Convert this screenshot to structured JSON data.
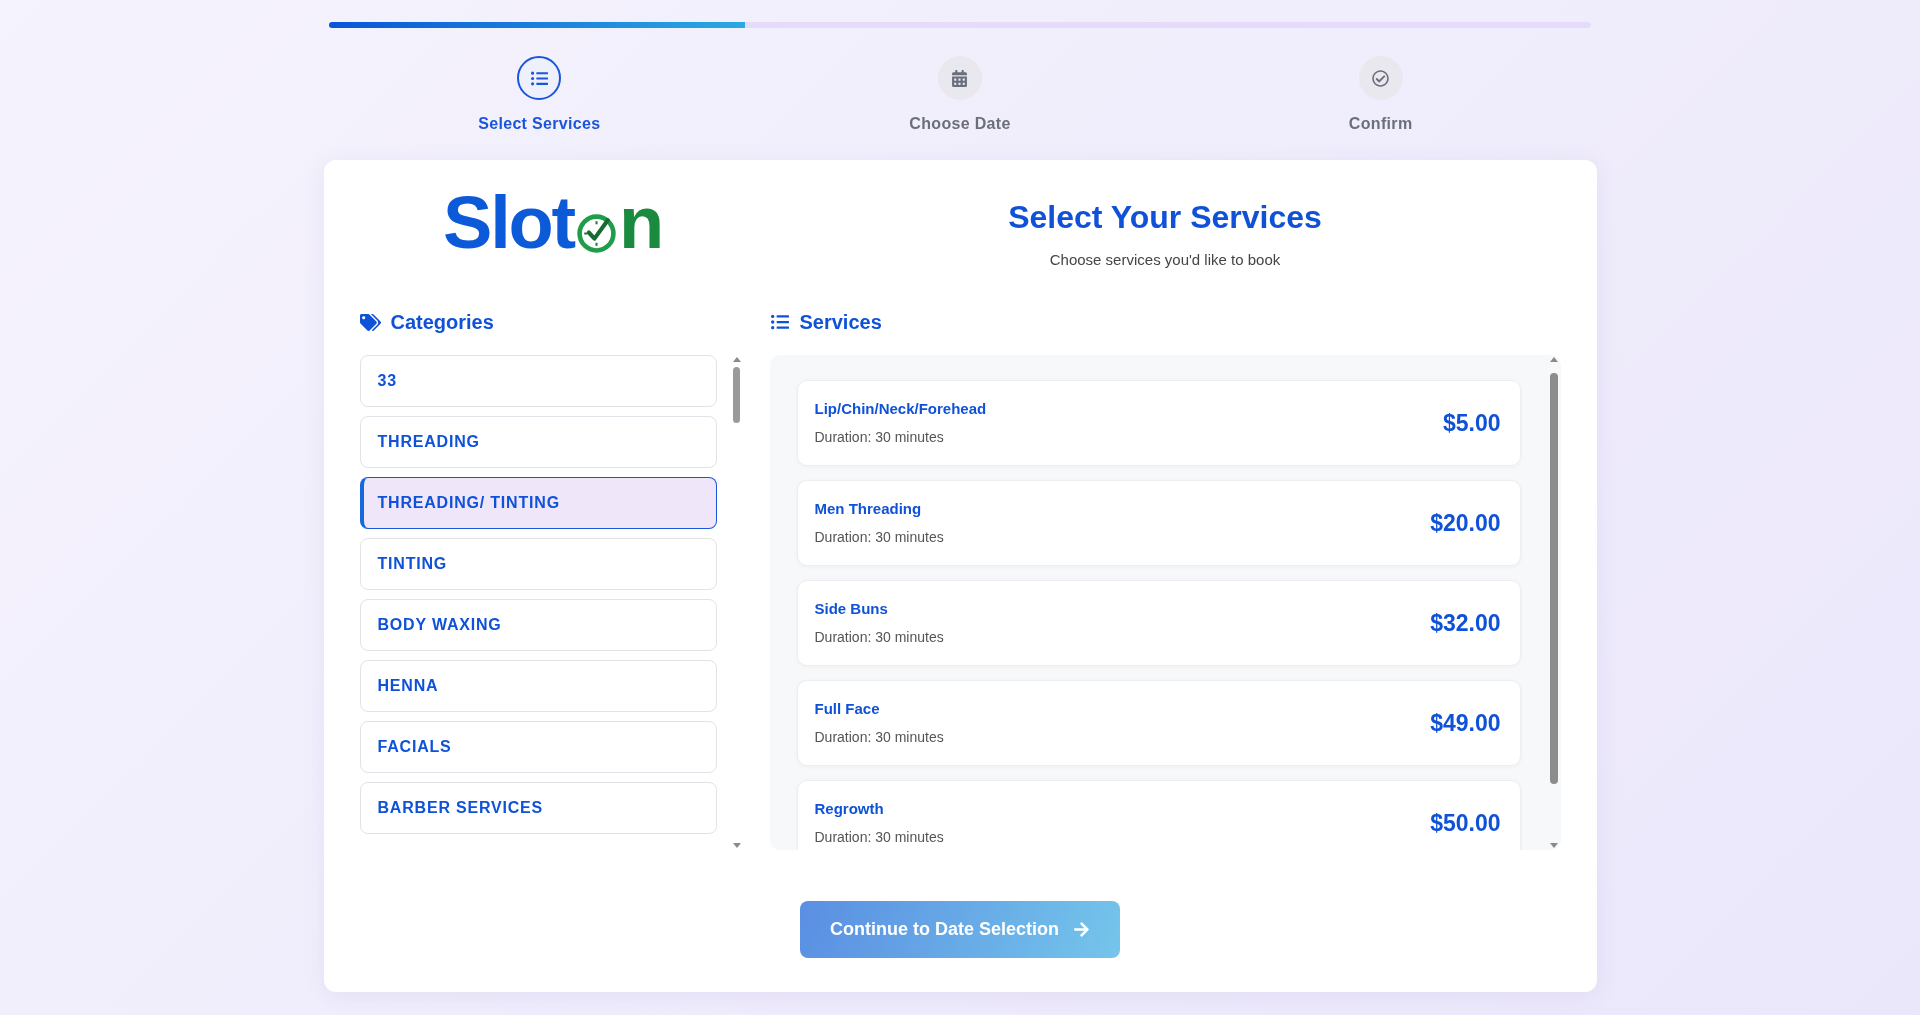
{
  "progress": {
    "level": 0.33
  },
  "steps": [
    {
      "label": "Select Services",
      "selected": true
    },
    {
      "label": "Choose Date",
      "selected": false
    },
    {
      "label": "Confirm",
      "selected": false
    }
  ],
  "logo": {
    "text_start": "Slot",
    "text_end": "n"
  },
  "header": {
    "title": "Select Your Services",
    "subtitle": "Choose services you'd like to book"
  },
  "categories": {
    "title": "Categories",
    "items": [
      {
        "label": "33",
        "selected": false
      },
      {
        "label": "THREADING",
        "selected": false
      },
      {
        "label": "THREADING/ TINTING",
        "selected": true
      },
      {
        "label": "TINTING",
        "selected": false
      },
      {
        "label": "BODY WAXING",
        "selected": false
      },
      {
        "label": "HENNA",
        "selected": false
      },
      {
        "label": "FACIALS",
        "selected": false
      },
      {
        "label": "BARBER SERVICES",
        "selected": false
      }
    ]
  },
  "services": {
    "title": "Services",
    "items": [
      {
        "name": "Lip/Chin/Neck/Forehead",
        "duration": "Duration: 30 minutes",
        "price": "$5.00"
      },
      {
        "name": "Men Threading",
        "duration": "Duration: 30 minutes",
        "price": "$20.00"
      },
      {
        "name": "Side Buns",
        "duration": "Duration: 30 minutes",
        "price": "$32.00"
      },
      {
        "name": "Full Face",
        "duration": "Duration: 30 minutes",
        "price": "$49.00"
      },
      {
        "name": "Regrowth",
        "duration": "Duration: 30 minutes",
        "price": "$50.00"
      }
    ]
  },
  "continue_button": {
    "label": "Continue to Date Selection"
  }
}
